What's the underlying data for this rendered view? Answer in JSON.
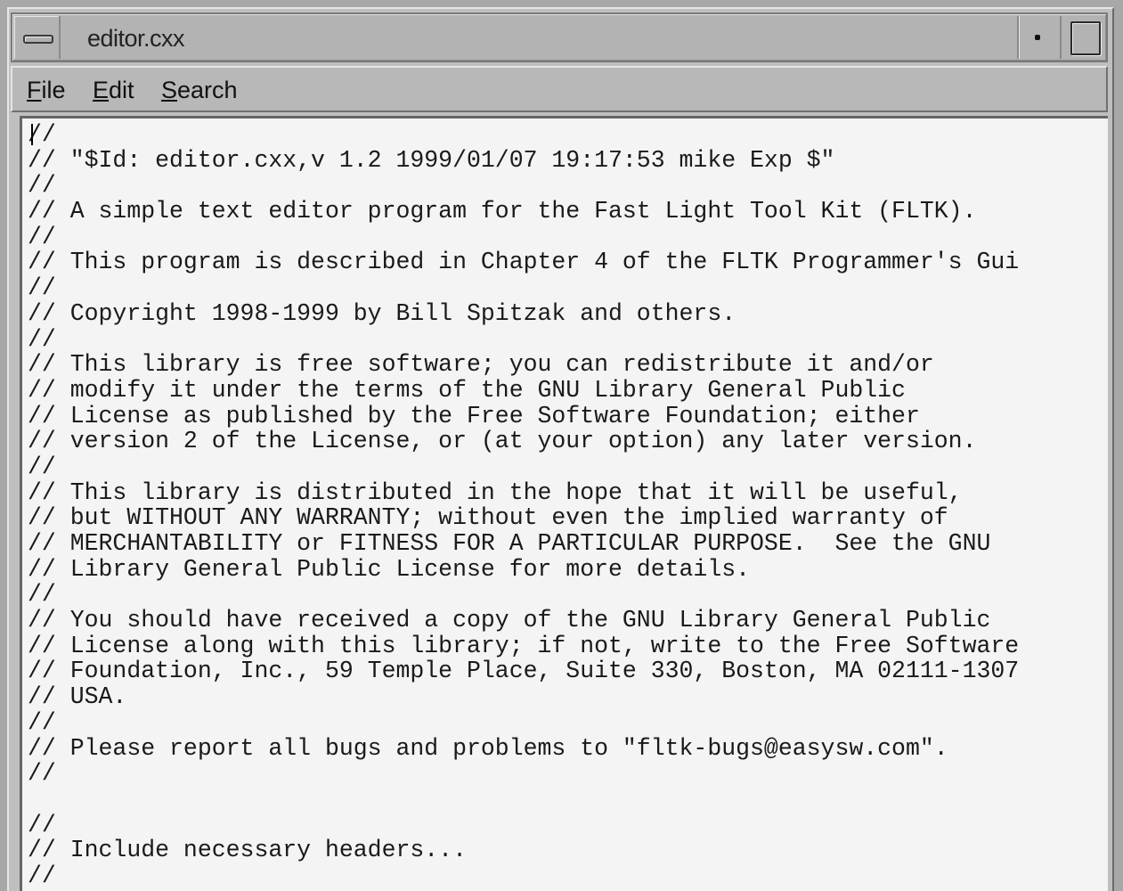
{
  "window": {
    "title": "editor.cxx"
  },
  "menubar": {
    "items": [
      {
        "first": "F",
        "rest": "ile"
      },
      {
        "first": "E",
        "rest": "dit"
      },
      {
        "first": "S",
        "rest": "earch"
      }
    ]
  },
  "editor": {
    "lines": [
      "//",
      "// \"$Id: editor.cxx,v 1.2 1999/01/07 19:17:53 mike Exp $\"",
      "//",
      "// A simple text editor program for the Fast Light Tool Kit (FLTK).",
      "//",
      "// This program is described in Chapter 4 of the FLTK Programmer's Gui",
      "//",
      "// Copyright 1998-1999 by Bill Spitzak and others.",
      "//",
      "// This library is free software; you can redistribute it and/or",
      "// modify it under the terms of the GNU Library General Public",
      "// License as published by the Free Software Foundation; either",
      "// version 2 of the License, or (at your option) any later version.",
      "//",
      "// This library is distributed in the hope that it will be useful,",
      "// but WITHOUT ANY WARRANTY; without even the implied warranty of",
      "// MERCHANTABILITY or FITNESS FOR A PARTICULAR PURPOSE.  See the GNU",
      "// Library General Public License for more details.",
      "//",
      "// You should have received a copy of the GNU Library General Public",
      "// License along with this library; if not, write to the Free Software",
      "// Foundation, Inc., 59 Temple Place, Suite 330, Boston, MA 02111-1307",
      "// USA.",
      "//",
      "// Please report all bugs and problems to \"fltk-bugs@easysw.com\".",
      "//",
      "",
      "//",
      "// Include necessary headers...",
      "//"
    ]
  }
}
